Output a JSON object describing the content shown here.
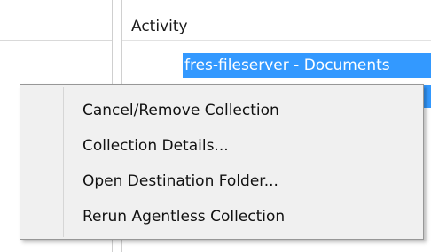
{
  "list": {
    "column_header": "Activity",
    "selected_row_text": "fres-fileserver - Documents"
  },
  "context_menu": {
    "items": [
      {
        "label": "Cancel/Remove Collection"
      },
      {
        "label": "Collection Details..."
      },
      {
        "label": "Open Destination Folder..."
      },
      {
        "label": "Rerun Agentless Collection"
      }
    ]
  },
  "colors": {
    "selection": "#3399ff",
    "menu_background": "#f0f0f0",
    "menu_border": "#979797"
  }
}
